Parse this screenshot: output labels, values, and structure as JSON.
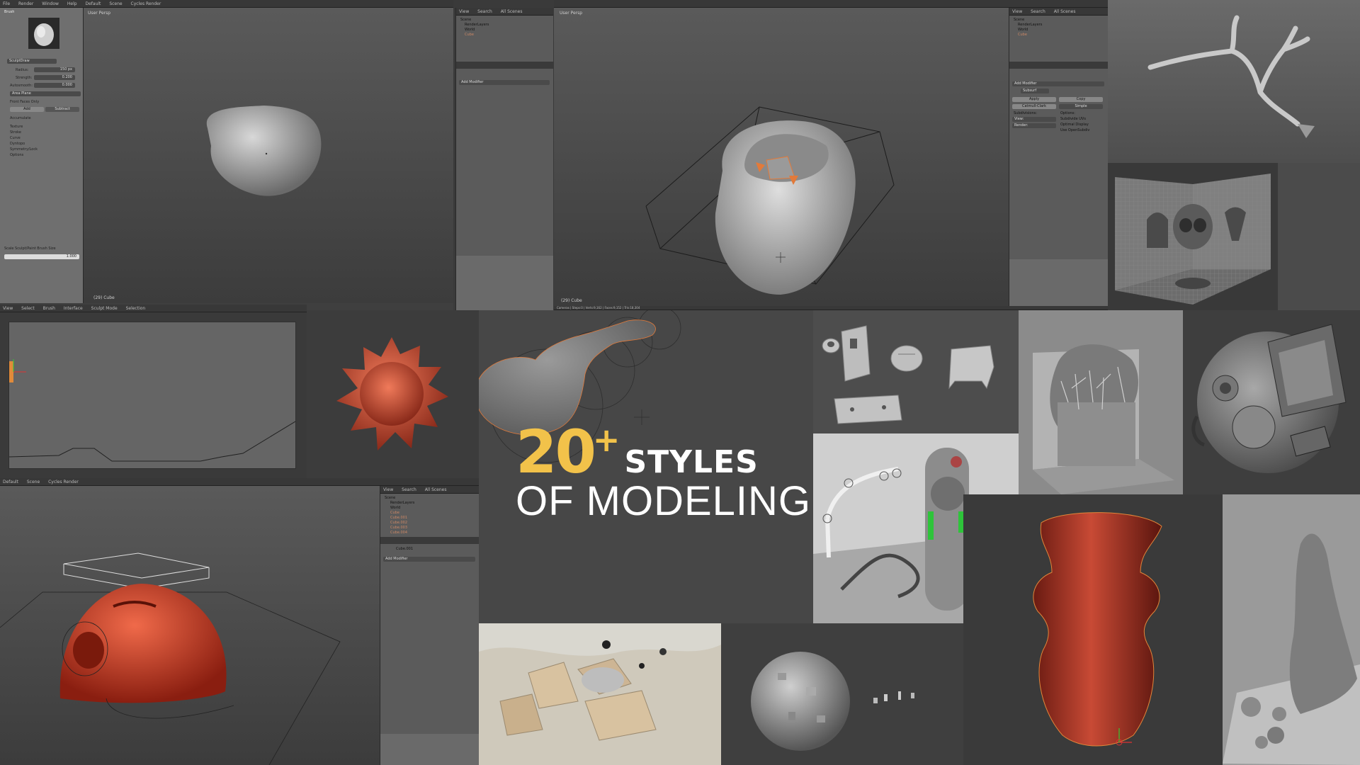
{
  "headline": {
    "number": "20",
    "plus": "+",
    "line1": "STYLES",
    "line2": "OF MODELING"
  },
  "editor_top_left": {
    "menu": [
      "File",
      "Render",
      "Window",
      "Help"
    ],
    "layout": "Default",
    "scene": "Scene",
    "renderer": "Cycles Render",
    "viewport_label": "User Persp",
    "object_label": "(29) Cube",
    "brush_panel": {
      "header": "Brush",
      "brush_name": "SculptDraw",
      "radius_label": "Radius:",
      "radius_value": "150 px",
      "strength_label": "Strength:",
      "strength_value": "0.200",
      "autosmooth_label": "Autosmooth:",
      "autosmooth_value": "0.000",
      "plane_label": "Area Plane",
      "front_faces": "Front Faces Only",
      "add": "Add",
      "subtract": "Subtract",
      "accumulate": "Accumulate",
      "sections": [
        "Texture",
        "Stroke",
        "Curve",
        "Dyntopo",
        "Symmetry/Lock",
        "Options"
      ],
      "scale_label": "Scale Sculpt/Paint Brush Size",
      "scale_value": "1.000"
    },
    "outliner": {
      "tabs": [
        "View",
        "Search",
        "All Scenes"
      ],
      "items": [
        "Scene",
        "RenderLayers",
        "World",
        "Cube"
      ]
    },
    "modifier": "Add Modifier"
  },
  "editor_top_right": {
    "viewport_label": "User Persp",
    "object_label": "(29) Cube",
    "status": "Cameras | Steps:0 | Verts:9,162 | Faces:9,152 | Tris:18,304",
    "outliner": {
      "tabs": [
        "View",
        "Search",
        "All Scenes"
      ],
      "items": [
        "Scene",
        "RenderLayers",
        "World",
        "Cube"
      ]
    },
    "modifier_panel": {
      "add": "Add Modifier",
      "name": "Subsurf",
      "apply": "Apply",
      "copy": "Copy",
      "catmull": "Catmull-Clark",
      "simple": "Simple",
      "subdivisions": "Subdivisions:",
      "view": "View:",
      "render": "Render:",
      "options": "Options:",
      "subdivide_uvs": "Subdivide UVs",
      "optimal": "Optimal Display",
      "opensubdiv": "Use OpenSubdiv"
    }
  },
  "uv_editor": {
    "menu": [
      "View",
      "Select",
      "Brush",
      "Interface"
    ],
    "mode": "Sculpt Mode",
    "selection": "Selection"
  },
  "editor_bottom_left": {
    "layout": "Default",
    "scene": "Scene",
    "renderer": "Cycles Render",
    "outliner": {
      "tabs": [
        "View",
        "Search",
        "All Scenes"
      ],
      "items": [
        "Scene",
        "RenderLayers",
        "World",
        "Cube",
        "Cube.001",
        "Cube.002",
        "Cube.003",
        "Cube.004"
      ]
    },
    "object": "Cube.001",
    "modifier": "Add Modifier"
  },
  "colors": {
    "accent_yellow": "#f2c24a",
    "clay_red": "#c8432d",
    "viewport_grey": "#4a4a4a",
    "panel_grey": "#6f6f6f"
  }
}
